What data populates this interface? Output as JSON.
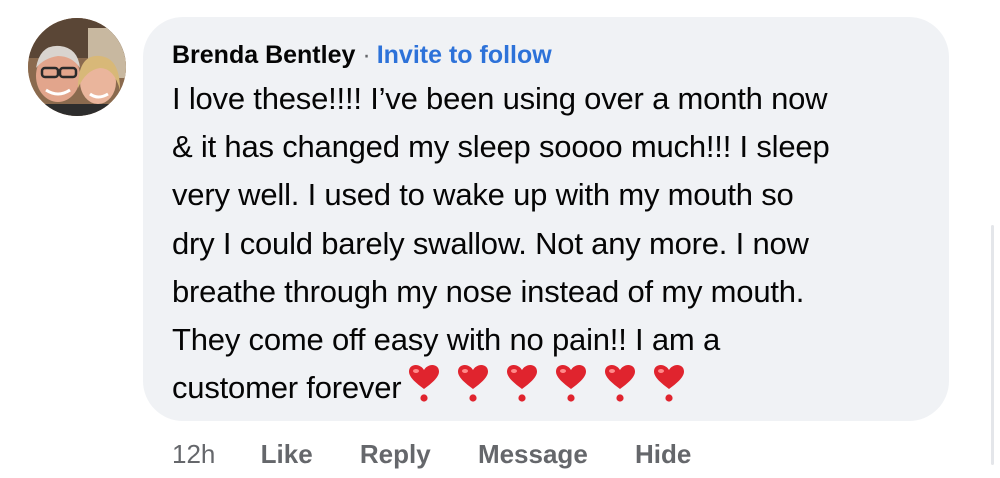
{
  "comment": {
    "author": "Brenda Bentley",
    "separator": "·",
    "invite_label": "Invite to follow",
    "body_lines": [
      "I love these!!!! I’ve been using over a month now",
      "& it has changed my sleep soooo much!!! I sleep",
      "very well.  I used to wake up with my mouth so",
      "dry I could barely swallow.  Not any more.  I now",
      "breathe through my nose instead of my mouth.",
      "They come off easy with no pain!! I am a",
      "customer forever"
    ],
    "emoji": [
      "heart-exclamation",
      "heart-exclamation",
      "heart-exclamation",
      "heart-exclamation",
      "heart-exclamation",
      "heart-exclamation"
    ],
    "emoji_color": "#e0242e"
  },
  "actions": {
    "time": "12h",
    "like": "Like",
    "reply": "Reply",
    "message": "Message",
    "hide": "Hide"
  },
  "colors": {
    "bubble": "#f0f2f5",
    "link": "#2d72d9",
    "muted": "#65676b",
    "text": "#050505"
  }
}
